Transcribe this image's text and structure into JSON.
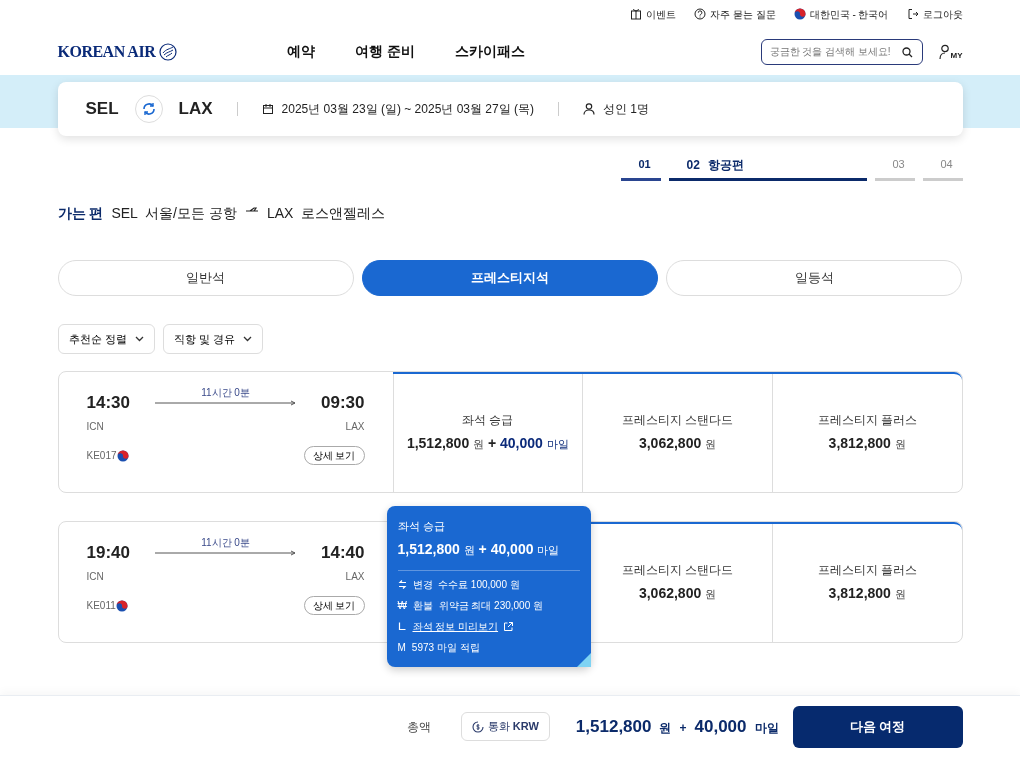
{
  "utility_links": [
    {
      "kind": "event",
      "label": "이벤트"
    },
    {
      "kind": "faq",
      "label": "자주 묻는 질문"
    },
    {
      "kind": "language",
      "label": "대한민국 - 한국어"
    },
    {
      "kind": "logout",
      "label": "로그아웃"
    }
  ],
  "logo": "KOREAN AIR",
  "nav": [
    "예약",
    "여행 준비",
    "스카이패스"
  ],
  "search": {
    "placeholder": "궁금한 것을 검색해 보세요!"
  },
  "my_label": "MY",
  "trip": {
    "from": "SEL",
    "to": "LAX",
    "dates": "2025년 03월 23일 (일) ~ 2025년 03월 27일 (목)",
    "passengers": "성인 1명"
  },
  "steps": [
    {
      "number": "01",
      "completed": true,
      "selected": false
    },
    {
      "number": "02",
      "label": "항공편",
      "completed": false,
      "selected": true
    },
    {
      "number": "03",
      "completed": false,
      "selected": false
    },
    {
      "number": "04",
      "completed": false,
      "selected": false
    }
  ],
  "direction": {
    "label": "가는 편",
    "from_code": "SEL",
    "from_name": "서울/모든 공항",
    "to_code": "LAX",
    "to_name": "로스앤젤레스"
  },
  "cabin_tabs": [
    {
      "label": "일반석",
      "selected": false
    },
    {
      "label": "프레스티지석",
      "selected": true
    },
    {
      "label": "일등석",
      "selected": false
    }
  ],
  "filters": [
    "추천순 정렬",
    "직항 및 경유"
  ],
  "flights": [
    {
      "depart_time": "14:30",
      "depart_airport": "ICN",
      "duration": "11시간 0분",
      "arrive_time": "09:30",
      "arrive_airport": "LAX",
      "flight_number": "KE017",
      "details_button": "상세 보기",
      "fares": [
        {
          "kind": "upgrade",
          "title": "좌석 승급",
          "price": "1,512,800",
          "currency": "원",
          "plus": "+",
          "miles": "40,000",
          "miles_unit": "마일"
        },
        {
          "kind": "cash",
          "title": "프레스티지 스탠다드",
          "price": "3,062,800",
          "currency": "원"
        },
        {
          "kind": "cash",
          "title": "프레스티지 플러스",
          "price": "3,812,800",
          "currency": "원"
        }
      ]
    },
    {
      "depart_time": "19:40",
      "depart_airport": "ICN",
      "duration": "11시간 0분",
      "arrive_time": "14:40",
      "arrive_airport": "LAX",
      "flight_number": "KE011",
      "details_button": "상세 보기",
      "fares": [
        {
          "kind": "popup",
          "title": "좌석 승급",
          "price": "1,512,800",
          "currency": "원",
          "plus": "+",
          "miles": "40,000",
          "miles_unit": "마일",
          "details": [
            {
              "kind": "change",
              "label": "변경",
              "text": "수수료 100,000 원"
            },
            {
              "kind": "refund",
              "symbol": "₩",
              "label": "환불",
              "text": "위약금 최대 230,000 원"
            },
            {
              "kind": "seat_link",
              "text": "좌석 정보 미리보기"
            },
            {
              "kind": "miles",
              "symbol": "M",
              "text": "5973 마일 적립"
            }
          ]
        },
        {
          "kind": "cash",
          "title": "프레스티지 스탠다드",
          "price": "3,062,800",
          "currency": "원"
        },
        {
          "kind": "cash",
          "title": "프레스티지 플러스",
          "price": "3,812,800",
          "currency": "원"
        }
      ]
    }
  ],
  "footer": {
    "total_label": "총액",
    "currency_button": "통화 **KRW**",
    "price": "1,512,800",
    "currency": "원",
    "plus": "+",
    "miles": "40,000",
    "miles_unit": "마일",
    "next_button": "다음 여정"
  }
}
